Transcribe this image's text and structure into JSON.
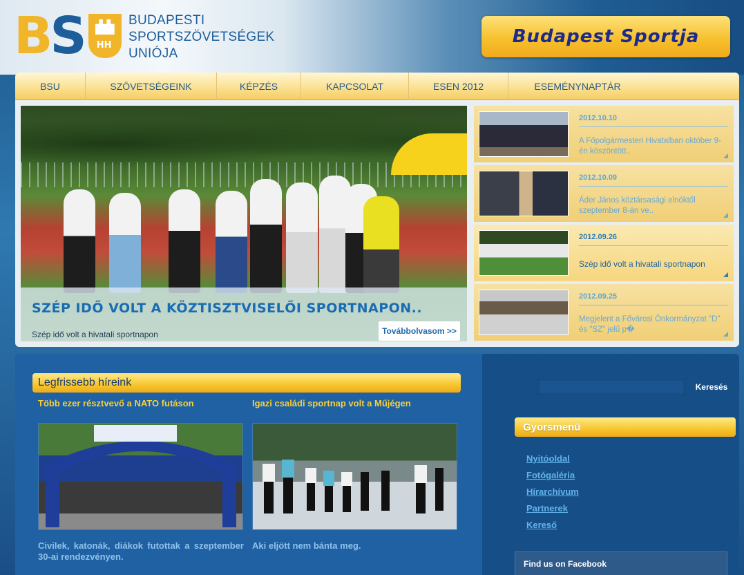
{
  "header": {
    "logo_letters": {
      "b": "B",
      "s": "S"
    },
    "org_name": [
      "BUDAPESTI",
      "SPORTSZÖVETSÉGEK",
      "UNIÓJA"
    ],
    "banner": "Budapest Sportja",
    "colors": {
      "logo_yellow": "#f0b528",
      "logo_blue": "#1d5d9a",
      "banner_text": "#1c2a8a"
    }
  },
  "nav": {
    "items": [
      {
        "label": "BSU"
      },
      {
        "label": "SZÖVETSÉGEINK"
      },
      {
        "label": "KÉPZÉS"
      },
      {
        "label": "KAPCSOLAT"
      },
      {
        "label": "ESEN 2012"
      },
      {
        "label": "ESEMÉNYNAPTÁR"
      }
    ]
  },
  "slider": {
    "title": "SZÉP IDŐ VOLT A KÖZTISZTVISELŐI SPORTNAPON..",
    "subtitle": "Szép idő volt a hivatali sportnapon",
    "more_label": "Továbbolvasom >>",
    "news": [
      {
        "date": "2012.10.10",
        "text": "A Főpolgármesteri Hivatalban október 9-én köszöntött.."
      },
      {
        "date": "2012.10.09",
        "text": "Áder János köztársasági elnöktől szeptember 8-án ve.."
      },
      {
        "date": "2012.09.26",
        "text": "Szép idő volt a hivatali sportnapon",
        "active": true
      },
      {
        "date": "2012.09.25",
        "text": "Megjelent a Fővárosi Önkormányzat \"D\" és \"SZ\" jelű p�"
      }
    ]
  },
  "main": {
    "section_title": "Legfrissebb híreink",
    "articles": [
      {
        "title": "Több ezer résztvevő a NATO futáson",
        "desc": "Civilek, katonák, diákok futottak a szeptember 30-ai rendezvényen."
      },
      {
        "title": "Igazi családi sportnap volt a Műjégen",
        "desc": "Aki eljött nem bánta meg."
      }
    ]
  },
  "sidebar": {
    "search_button": "Keresés",
    "quick_title": "Gyorsmenü",
    "quick_links": [
      "Nyitóoldal",
      "Fotógaléria",
      "Hírarchívum",
      "Partnerek",
      "Kereső"
    ],
    "facebook_title": "Find us on Facebook"
  }
}
